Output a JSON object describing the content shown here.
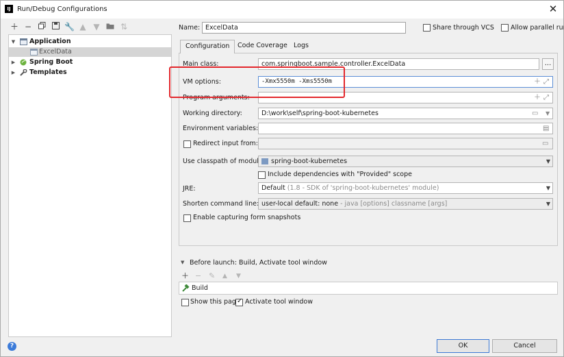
{
  "window": {
    "title": "Run/Debug Configurations",
    "icon_text": "IJ"
  },
  "toolbar": {
    "icons": [
      "add-icon",
      "remove-icon",
      "copy-icon",
      "save-icon",
      "wrench-icon",
      "move-up-icon",
      "move-down-icon",
      "folder-icon",
      "sort-icon"
    ]
  },
  "tree": {
    "items": [
      {
        "label": "Application"
      },
      {
        "label": "ExcelData"
      },
      {
        "label": "Spring Boot"
      },
      {
        "label": "Templates"
      }
    ]
  },
  "header": {
    "name_label": "Name:",
    "name_value": "ExcelData",
    "share_vcs_label": "Share through VCS",
    "allow_parallel_label": "Allow parallel run"
  },
  "tabs": [
    {
      "label": "Configuration",
      "active": true
    },
    {
      "label": "Code Coverage"
    },
    {
      "label": "Logs"
    }
  ],
  "config": {
    "main_class_label": "Main class:",
    "main_class_value": "com.springboot.sample.controller.ExcelData",
    "main_class_button": "...",
    "vm_options_label": "VM options:",
    "vm_options_value": "-Xmx5550m -Xms5550m",
    "program_args_label": "Program arguments:",
    "program_args_value": "",
    "working_dir_label": "Working directory:",
    "working_dir_value": "D:\\work\\self\\spring-boot-kubernetes",
    "env_vars_label": "Environment variables:",
    "env_vars_value": "",
    "redirect_input_label": "Redirect input from:",
    "classpath_label": "Use classpath of module:",
    "classpath_value": "spring-boot-kubernetes",
    "include_provided_label": "Include dependencies with \"Provided\" scope",
    "jre_label": "JRE:",
    "jre_value": "Default",
    "jre_hint": "(1.8 - SDK of 'spring-boot-kubernetes' module)",
    "shorten_label": "Shorten command line:",
    "shorten_value": "user-local default: none",
    "shorten_hint": "- java [options] classname [args]",
    "capture_label": "Enable capturing form snapshots"
  },
  "before_launch": {
    "label": "Before launch: Build, Activate tool window",
    "items": [
      {
        "label": "Build"
      }
    ],
    "show_page_label": "Show this page",
    "activate_tool_label": "Activate tool window"
  },
  "buttons": {
    "ok": "OK",
    "cancel": "Cancel"
  },
  "colors": {
    "highlight_box": "#e3262b",
    "ok_border": "#3a78d4",
    "selection": "#d5d5d5"
  }
}
